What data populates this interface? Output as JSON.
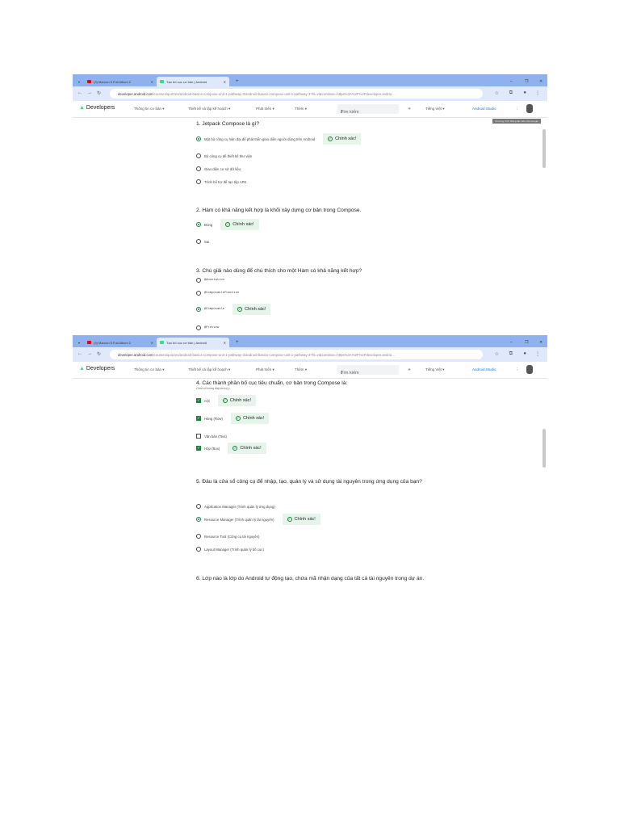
{
  "browser": {
    "tabs": [
      "(3) Maroon 5 Full Album 2",
      "Tạo bố cục cơ bản | Android"
    ],
    "url_host": "developer.android.com",
    "url_path": "/courses/quizzes/android-basics-compose-unit-1-pathway-3/android-basics-compose-unit-1-pathway-3?hl=vi&continue=https%3A%2F%2Fdeveloper.androi...",
    "nav": {
      "logo": "Developers",
      "items": [
        "Thông tin cơ bản ▾",
        "Thiết kế và lập kế hoạch ▾",
        "Phát triển ▾",
        "Thêm ▾"
      ],
      "search": "Tìm kiếm",
      "slash": "/",
      "language": "Tiếng Việt ▾",
      "studio": "Android Studio"
    },
    "tooltip": "Chương trình Nhà phát triển của Google"
  },
  "correct_label": "Chính xác!",
  "shot1": [
    {
      "q": "1. Jetpack Compose là gì?",
      "type": "radio",
      "options": [
        {
          "t": "Một bộ công cụ hiện đại để phát triển giao diện người dùng trên Android",
          "on": true,
          "ok": true
        },
        {
          "t": "Bộ công cụ để thiết kế thư viện"
        },
        {
          "t": "Giao diện cơ sở dữ liệu"
        },
        {
          "t": "Trình bổ trợ để tạo tệp APK"
        }
      ]
    },
    {
      "q": "2. Hàm có khả năng kết hợp là khối xây dựng cơ bản trong Compose.",
      "type": "radio",
      "options": [
        {
          "t": "Đúng",
          "on": true,
          "ok": true
        },
        {
          "t": "Sai"
        }
      ]
    },
    {
      "q": "3. Chú giải nào dùng để chú thích cho một Hàm có khả năng kết hợp?",
      "type": "radio",
      "mono": true,
      "options": [
        {
          "t": "@Annotation"
        },
        {
          "t": "@ComposableFunction"
        },
        {
          "t": "@Composable",
          "on": true,
          "ok": true
        },
        {
          "t": "@Preview"
        }
      ]
    }
  ],
  "shot2": [
    {
      "q": "4. Các thành phần bố cục tiêu chuẩn, cơ bản trong Compose là:",
      "sub": "Chọn số lượng đáp án tuỳ ý",
      "type": "check",
      "options": [
        {
          "t": "Cột",
          "on": true,
          "ok": true
        },
        {
          "t": "Hàng (Row)",
          "on": true,
          "ok": true
        },
        {
          "t": "Văn bản (Text)"
        },
        {
          "t": "Hộp (Box)",
          "on": true,
          "ok": true
        }
      ]
    },
    {
      "q": "5. Đâu là cửa sổ công cụ để nhập, tạo, quản lý và sử dụng tài nguyên trong ứng dụng của bạn?",
      "type": "radio",
      "options": [
        {
          "t": "Application Manager (Trình quản lý ứng dụng)"
        },
        {
          "t": "Resource Manager (Trình quản lý tài nguyên)",
          "on": true,
          "ok": true
        },
        {
          "t": "Resource Tool (Công cụ tài nguyên)"
        },
        {
          "t": "Layout Manager (Trình quản lý bố cục)"
        }
      ]
    },
    {
      "q": "6. Lớp nào là lớp do Android tự động tạo, chứa mã nhận dạng của tất cả tài nguyên trong dự án.",
      "type": "radio",
      "options": []
    }
  ]
}
